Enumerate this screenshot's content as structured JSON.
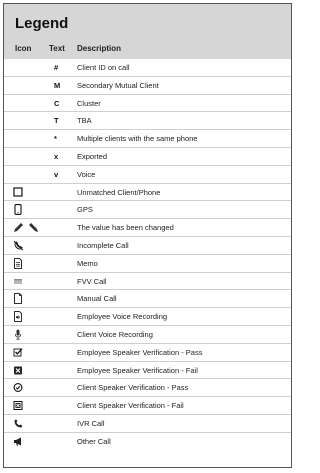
{
  "legend": {
    "title": "Legend",
    "columns": {
      "icon": "Icon",
      "text": "Text",
      "description": "Description"
    },
    "rows": [
      {
        "icon": "",
        "text": "#",
        "description": "Client ID on call"
      },
      {
        "icon": "",
        "text": "M",
        "description": "Secondary Mutual Client"
      },
      {
        "icon": "",
        "text": "C",
        "description": "Cluster"
      },
      {
        "icon": "",
        "text": "T",
        "description": "TBA"
      },
      {
        "icon": "",
        "text": "*",
        "description": "Multiple clients with the same phone"
      },
      {
        "icon": "",
        "text": "x",
        "description": "Exported"
      },
      {
        "icon": "",
        "text": "v",
        "description": "Voice"
      },
      {
        "icon": "square-outline-icon",
        "text": "",
        "description": "Unmatched Client/Phone"
      },
      {
        "icon": "mobile-phone-icon",
        "text": "",
        "description": "GPS"
      },
      {
        "icon": "pencil-icons",
        "text": "",
        "description": "The value has been changed"
      },
      {
        "icon": "cancelled-phone-icon",
        "text": "",
        "description": "Incomplete Call"
      },
      {
        "icon": "memo-document-icon",
        "text": "",
        "description": "Memo"
      },
      {
        "icon": "fvv-card-icon",
        "text": "",
        "description": "FVV Call"
      },
      {
        "icon": "blank-document-icon",
        "text": "",
        "description": "Manual Call"
      },
      {
        "icon": "audio-file-icon",
        "text": "",
        "description": "Employee Voice Recording"
      },
      {
        "icon": "microphone-icon",
        "text": "",
        "description": "Client Voice Recording"
      },
      {
        "icon": "checked-checkbox-icon",
        "text": "",
        "description": "Employee Speaker Verification - Pass"
      },
      {
        "icon": "x-box-icon",
        "text": "",
        "description": "Employee Speaker Verification - Fail"
      },
      {
        "icon": "check-circle-icon",
        "text": "",
        "description": "Client Speaker Verification - Pass"
      },
      {
        "icon": "x-box-outline-icon",
        "text": "",
        "description": "Client Speaker Verification - Fail"
      },
      {
        "icon": "phone-handset-icon",
        "text": "",
        "description": "IVR Call"
      },
      {
        "icon": "megaphone-icon",
        "text": "",
        "description": "Other Call"
      }
    ]
  }
}
